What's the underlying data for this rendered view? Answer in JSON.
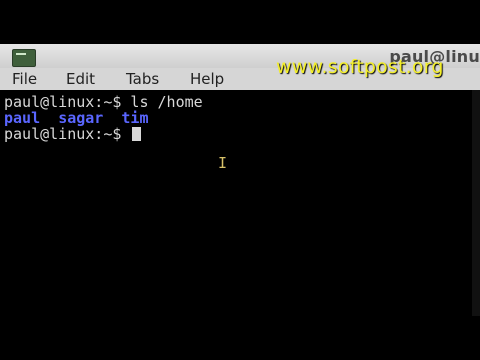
{
  "window": {
    "title": "paul@linu"
  },
  "menubar": {
    "items": [
      "File",
      "Edit",
      "Tabs",
      "Help"
    ]
  },
  "terminal": {
    "line1": "paul@linux:~$ ls /home",
    "dirs": [
      "paul",
      "sagar",
      "tim"
    ],
    "prompt": "paul@linux:~$ "
  },
  "watermark": {
    "text": "www.softpost.org"
  },
  "colors": {
    "terminal_bg": "#000000",
    "text": "#d8d8d8",
    "directory": "#5a66ff",
    "watermark": "#f4ef2b",
    "menubar": "#d6d6d6"
  },
  "icons": {
    "app": "terminal-icon",
    "pointer": "i-beam-cursor-icon"
  }
}
